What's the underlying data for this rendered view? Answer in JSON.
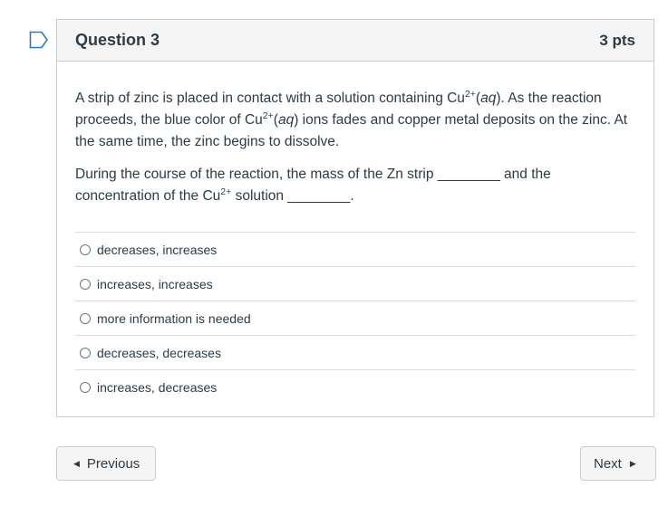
{
  "question": {
    "title": "Question 3",
    "points": "3 pts",
    "paragraph1": {
      "t1": "A strip of zinc is placed in contact with a solution containing Cu",
      "sup1": "2+",
      "t2": "(",
      "i1": "aq",
      "t3": ").  As the reaction proceeds, the blue color of Cu",
      "sup2": "2+",
      "t4": "(",
      "i2": "aq",
      "t5": ") ions fades and copper metal deposits on the zinc.  At the same time, the zinc begins to dissolve."
    },
    "paragraph2": {
      "t1": "During the course of the reaction, the mass of the Zn strip ________ and the concentration of the Cu",
      "sup1": "2+",
      "t2": " solution ________."
    },
    "answers": [
      "decreases, increases",
      "increases, increases",
      "more information is needed",
      "decreases, decreases",
      "increases, decreases"
    ]
  },
  "navigation": {
    "previous_label": "Previous",
    "next_label": "Next"
  },
  "colors": {
    "flag_accent": "#2b7abc",
    "text": "#2d3b45",
    "border": "#c7cdd1",
    "header_bg": "#f5f5f5"
  },
  "icons": {
    "flag": "flag-question-icon",
    "prev_caret": "caret-left-icon",
    "next_caret": "caret-right-icon"
  }
}
